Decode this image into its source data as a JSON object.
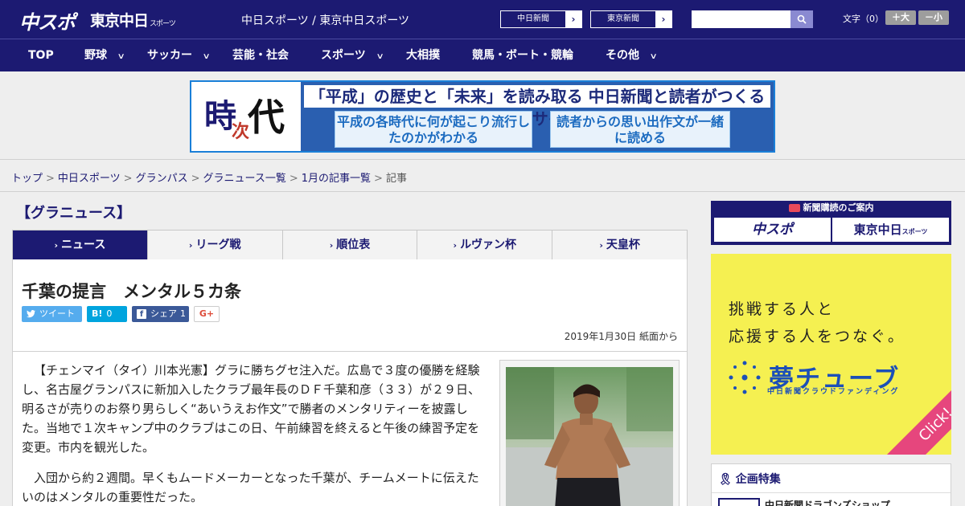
{
  "header": {
    "logo_chuspo": "中スポ",
    "logo_tokyo": "東京中日",
    "logo_tokyo_small": "スポーツ",
    "site_links": "中日スポーツ / 東京中日スポーツ",
    "btn_chunichi": "中日新聞",
    "btn_tokyo": "東京新聞",
    "search_placeholder": "",
    "fontsize_label": "文字（0）",
    "fs_large": "＋大",
    "fs_small": "－小"
  },
  "nav": {
    "items": [
      "TOP",
      "野球",
      "サッカー",
      "芸能・社会",
      "スポーツ",
      "大相撲",
      "競馬・ボート・競輪",
      "その他"
    ],
    "chevron": "∨"
  },
  "banner": {
    "kanji_1": "時",
    "kanji_2": "次",
    "kanji_3": "代",
    "top_text": "「平成」の歴史と「未来」を読み取る  中日新聞と読者がつくるWebサイト",
    "box_1": "平成の各時代に何が起こり流行したのかがわかる",
    "box_2": "読者からの思い出作文が一緒に読める"
  },
  "breadcrumb": {
    "items": [
      "トップ",
      "中日スポーツ",
      "グランパス",
      "グラニュース一覧",
      "1月の記事一覧"
    ],
    "current": "記事",
    "sep": ">"
  },
  "section_title": "【グラニュース】",
  "tabs": [
    {
      "label": "ニュース",
      "active": true
    },
    {
      "label": "リーグ戦",
      "active": false
    },
    {
      "label": "順位表",
      "active": false
    },
    {
      "label": "ルヴァン杯",
      "active": false
    },
    {
      "label": "天皇杯",
      "active": false
    }
  ],
  "tab_marker": "›",
  "article": {
    "title": "千葉の提言　メンタル５カ条",
    "share_tweet": "ツイート",
    "share_hatena_icon": "B!",
    "share_hatena_count": "0",
    "share_fb": "シェア",
    "share_fb_count": "1",
    "share_gplus": "G+",
    "date": "2019年1月30日 紙面から",
    "paragraphs": [
      "【チェンマイ（タイ）川本光憲】グラに勝ちグセ注入だ。広島で３度の優勝を経験し、名古屋グランパスに新加入したクラブ最年長のＤＦ千葉和彦（３３）が２９日、明るさが売りのお祭り男らしく“あいうえお作文”で勝者のメンタリティーを披露した。当地で１次キャンプ中のクラブはこの日、午前練習を終えると午後の練習予定を変更。市内を観光した。",
      "入団から約２週間。早くもムードメーカーとなった千葉が、チームメートに伝えたいのはメンタルの重要性だった。"
    ]
  },
  "sidebar": {
    "subs_head": "新聞購読のご案内",
    "subs_chuspo": "中スポ",
    "subs_tokyo": "東京中日",
    "subs_tokyo_small": "スポーツ",
    "ad_line1": "挑戦する人と",
    "ad_line2": "応援する人をつなぐ。",
    "ad_logo": "夢チューブ",
    "ad_sub": "中日新聞クラウドファンディング",
    "ad_click": "Click!",
    "kikaku_title": "企画特集",
    "kikaku_item": "中日新聞ドラゴンズショップ"
  },
  "colors": {
    "brand_navy": "#1c1a72",
    "ad_yellow": "#f5f051",
    "ad_blue": "#1c4fb8",
    "click_pink": "#e6467d",
    "twitter": "#55acee",
    "hatena": "#00a4de",
    "facebook": "#3b5998"
  }
}
